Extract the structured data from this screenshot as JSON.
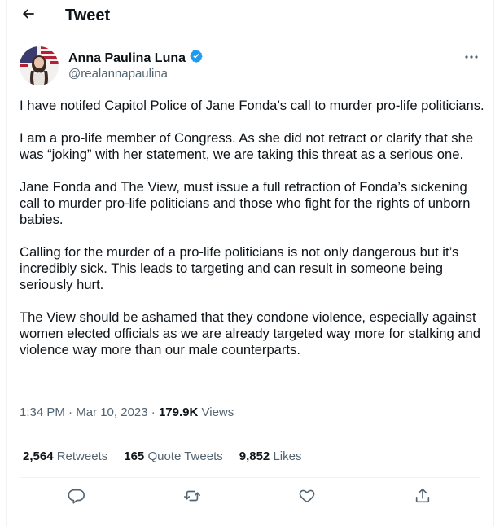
{
  "header": {
    "title": "Tweet"
  },
  "author": {
    "display_name": "Anna Paulina Luna",
    "handle": "@realannapaulina",
    "verified": true
  },
  "tweet": {
    "paragraphs": [
      "I have notifed Capitol Police of Jane Fonda’s call to murder pro-life politicians.",
      "I am a pro-life member of Congress.  As she did not retract or clarify that she was “joking” with her statement, we are taking this threat as a serious one.",
      "Jane Fonda and The View, must issue a full retraction of Fonda’s sickening call to murder pro-life politicians and those who fight for the rights of unborn babies.",
      "Calling for the murder of a pro-life politicians is not only dangerous but it’s incredibly sick. This leads to targeting and can result in someone being seriously hurt.",
      "The View should be ashamed that they condone violence, especially against women elected officials as we are already targeted way more for stalking and violence way more than our male counterparts."
    ]
  },
  "meta": {
    "time": "1:34 PM",
    "separator": "·",
    "date": "Mar 10, 2023",
    "views_count": "179.9K",
    "views_label": "Views"
  },
  "stats": {
    "retweets": {
      "count": "2,564",
      "label": "Retweets"
    },
    "quote_tweets": {
      "count": "165",
      "label": "Quote Tweets"
    },
    "likes": {
      "count": "9,852",
      "label": "Likes"
    }
  },
  "icons": {
    "back": "back-arrow-icon",
    "verified": "verified-badge-icon",
    "more": "more-icon",
    "reply": "reply-icon",
    "retweet": "retweet-icon",
    "like": "like-icon",
    "share": "share-icon"
  },
  "colors": {
    "text_primary": "#0f1419",
    "text_secondary": "#536471",
    "verified_blue": "#1d9bf0",
    "divider": "#eff3f4"
  }
}
